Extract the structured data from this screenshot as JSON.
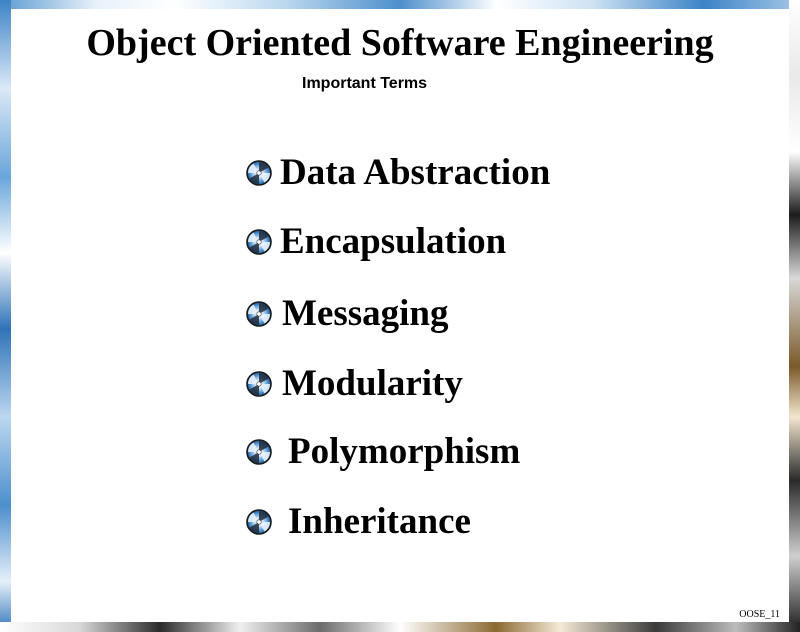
{
  "slide": {
    "title": "Object Oriented Software Engineering",
    "subtitle": "Important Terms",
    "terms": [
      {
        "label": "Data Abstraction",
        "icon": "bullet-disc-icon"
      },
      {
        "label": "Encapsulation",
        "icon": "bullet-disc-icon"
      },
      {
        "label": "Messaging",
        "icon": "bullet-disc-icon"
      },
      {
        "label": "Modularity",
        "icon": "bullet-disc-icon"
      },
      {
        "label": "Polymorphism",
        "icon": "bullet-disc-icon"
      },
      {
        "label": "Inheritance",
        "icon": "bullet-disc-icon"
      }
    ],
    "footer": "OOSE_11"
  },
  "colors": {
    "text": "#000000",
    "background": "#ffffff",
    "frame_blue": "#3c83c7",
    "bullet_blue": "#4a8fd0"
  }
}
